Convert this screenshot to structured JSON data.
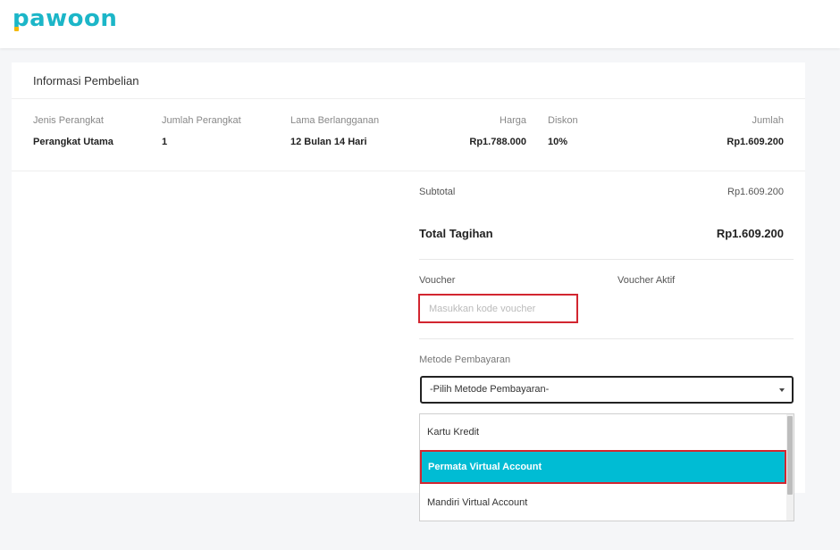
{
  "header": {
    "logo": "pawoon"
  },
  "card": {
    "title": "Informasi Pembelian"
  },
  "table": {
    "headers": {
      "device_type": "Jenis Perangkat",
      "device_count": "Jumlah Perangkat",
      "duration": "Lama Berlangganan",
      "price": "Harga",
      "discount": "Diskon",
      "amount": "Jumlah"
    },
    "row": {
      "device_type": "Perangkat Utama",
      "device_count": "1",
      "duration": "12 Bulan 14 Hari",
      "price": "Rp1.788.000",
      "discount": "10%",
      "amount": "Rp1.609.200"
    }
  },
  "summary": {
    "subtotal_label": "Subtotal",
    "subtotal_value": "Rp1.609.200",
    "total_label": "Total Tagihan",
    "total_value": "Rp1.609.200"
  },
  "voucher": {
    "label": "Voucher",
    "active_label": "Voucher Aktif",
    "placeholder": "Masukkan kode voucher"
  },
  "payment": {
    "label": "Metode Pembayaran",
    "selected": "-Pilih Metode Pembayaran-",
    "options": [
      "Kartu Kredit",
      "Permata Virtual Account",
      "Mandiri Virtual Account"
    ]
  },
  "colors": {
    "brand": "#1cb6c8",
    "highlight": "#00bcd4",
    "annotation": "#d22630"
  },
  "icons": {
    "dropdown": "caret-down-icon"
  }
}
